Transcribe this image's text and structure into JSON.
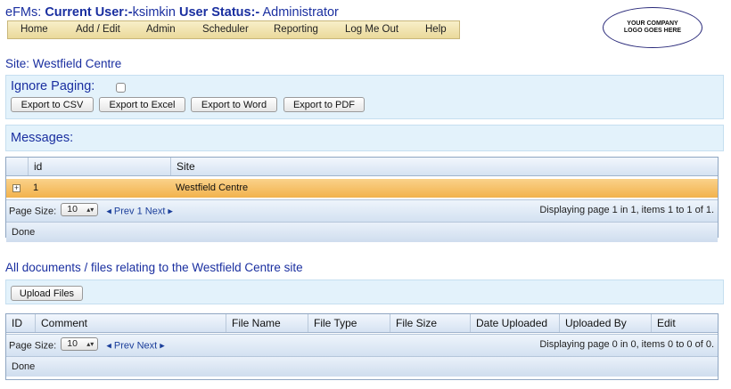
{
  "header": {
    "app": "eFMs:",
    "current_user_label": "Current User:-",
    "current_user": "ksimkin",
    "user_status_label": "User Status:-",
    "user_status": "Administrator"
  },
  "nav": {
    "items": [
      "Home",
      "Add / Edit",
      "Admin",
      "Scheduler",
      "Reporting",
      "Log Me Out",
      "Help"
    ]
  },
  "logo": {
    "text": "YOUR COMPANY LOGO GOES HERE"
  },
  "site": {
    "title": "Site: Westfield Centre"
  },
  "paging": {
    "ignore_label": "Ignore Paging:",
    "ignore_checked": false,
    "export_buttons": [
      "Export to CSV",
      "Export to Excel",
      "Export to Word",
      "Export to PDF"
    ]
  },
  "messages": {
    "label": "Messages:",
    "columns": [
      "id",
      "Site"
    ],
    "rows": [
      {
        "id": "1",
        "site": "Westfield Centre"
      }
    ],
    "pager": {
      "page_size_label": "Page Size:",
      "page_size": "10",
      "nav_text": "◂ Prev 1 Next ▸",
      "summary": "Displaying page 1 in 1, items 1 to 1 of 1."
    },
    "status": "Done"
  },
  "documents": {
    "title": "All documents / files relating to the Westfield Centre site",
    "upload_label": "Upload Files",
    "columns": [
      "ID",
      "Comment",
      "File Name",
      "File Type",
      "File Size",
      "Date Uploaded",
      "Uploaded By",
      "Edit"
    ],
    "pager": {
      "page_size_label": "Page Size:",
      "page_size": "10",
      "nav_text": "◂ Prev Next ▸",
      "summary": "Displaying page 0 in 0, items 0 to 0 of 0."
    },
    "status": "Done"
  },
  "colors": {
    "heading_blue": "#1a2fa0",
    "selected_row": "#f2b24c",
    "panel_bg": "#e3f2fb"
  }
}
